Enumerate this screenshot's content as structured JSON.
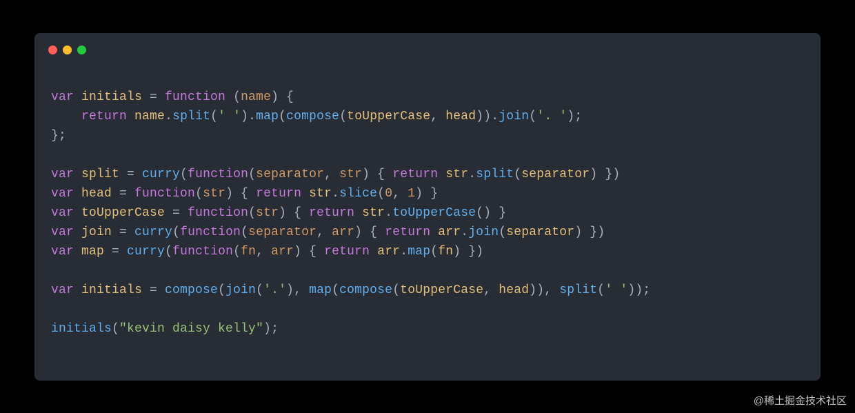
{
  "language": "javascript",
  "theme": "one-dark",
  "watermark": "@稀土掘金技术社区",
  "traffic_lights": [
    "close",
    "minimize",
    "zoom"
  ],
  "code_lines": [
    "",
    "var initials = function (name) {",
    "    return name.split(' ').map(compose(toUpperCase, head)).join('. ');",
    "};",
    "",
    "var split = curry(function(separator, str) { return str.split(separator) })",
    "var head = function(str) { return str.slice(0, 1) }",
    "var toUpperCase = function(str) { return str.toUpperCase() }",
    "var join = curry(function(separator, arr) { return arr.join(separator) })",
    "var map = curry(function(fn, arr) { return arr.map(fn) })",
    "",
    "var initials = compose(join('.'), map(compose(toUpperCase, head)), split(' '));",
    "",
    "initials(\"kevin daisy kelly\");",
    ""
  ],
  "tokens": {
    "blank": [
      {
        "t": " ",
        "c": "pl"
      }
    ],
    "l1": [
      {
        "t": "var ",
        "c": "kw"
      },
      {
        "t": "initials",
        "c": "vn"
      },
      {
        "t": " = ",
        "c": "pl"
      },
      {
        "t": "function",
        "c": "kw"
      },
      {
        "t": " (",
        "c": "pl"
      },
      {
        "t": "name",
        "c": "pn"
      },
      {
        "t": ") {",
        "c": "pl"
      }
    ],
    "l2": [
      {
        "t": "    ",
        "c": "pl"
      },
      {
        "t": "return",
        "c": "kw"
      },
      {
        "t": " ",
        "c": "pl"
      },
      {
        "t": "name",
        "c": "vn"
      },
      {
        "t": ".",
        "c": "pl"
      },
      {
        "t": "split",
        "c": "fnn"
      },
      {
        "t": "(",
        "c": "pl"
      },
      {
        "t": "' '",
        "c": "str"
      },
      {
        "t": ").",
        "c": "pl"
      },
      {
        "t": "map",
        "c": "fnn"
      },
      {
        "t": "(",
        "c": "pl"
      },
      {
        "t": "compose",
        "c": "fnn"
      },
      {
        "t": "(",
        "c": "pl"
      },
      {
        "t": "toUpperCase",
        "c": "vn"
      },
      {
        "t": ", ",
        "c": "pl"
      },
      {
        "t": "head",
        "c": "vn"
      },
      {
        "t": ")).",
        "c": "pl"
      },
      {
        "t": "join",
        "c": "fnn"
      },
      {
        "t": "(",
        "c": "pl"
      },
      {
        "t": "'. '",
        "c": "str"
      },
      {
        "t": ");",
        "c": "pl"
      }
    ],
    "l3": [
      {
        "t": "};",
        "c": "pl"
      }
    ],
    "l5": [
      {
        "t": "var ",
        "c": "kw"
      },
      {
        "t": "split",
        "c": "vn"
      },
      {
        "t": " = ",
        "c": "pl"
      },
      {
        "t": "curry",
        "c": "fnn"
      },
      {
        "t": "(",
        "c": "pl"
      },
      {
        "t": "function",
        "c": "kw"
      },
      {
        "t": "(",
        "c": "pl"
      },
      {
        "t": "separator",
        "c": "pn"
      },
      {
        "t": ", ",
        "c": "pl"
      },
      {
        "t": "str",
        "c": "pn"
      },
      {
        "t": ") { ",
        "c": "pl"
      },
      {
        "t": "return",
        "c": "kw"
      },
      {
        "t": " ",
        "c": "pl"
      },
      {
        "t": "str",
        "c": "vn"
      },
      {
        "t": ".",
        "c": "pl"
      },
      {
        "t": "split",
        "c": "fnn"
      },
      {
        "t": "(",
        "c": "pl"
      },
      {
        "t": "separator",
        "c": "vn"
      },
      {
        "t": ") })",
        "c": "pl"
      }
    ],
    "l6": [
      {
        "t": "var ",
        "c": "kw"
      },
      {
        "t": "head",
        "c": "vn"
      },
      {
        "t": " = ",
        "c": "pl"
      },
      {
        "t": "function",
        "c": "kw"
      },
      {
        "t": "(",
        "c": "pl"
      },
      {
        "t": "str",
        "c": "pn"
      },
      {
        "t": ") { ",
        "c": "pl"
      },
      {
        "t": "return",
        "c": "kw"
      },
      {
        "t": " ",
        "c": "pl"
      },
      {
        "t": "str",
        "c": "vn"
      },
      {
        "t": ".",
        "c": "pl"
      },
      {
        "t": "slice",
        "c": "fnn"
      },
      {
        "t": "(",
        "c": "pl"
      },
      {
        "t": "0",
        "c": "num"
      },
      {
        "t": ", ",
        "c": "pl"
      },
      {
        "t": "1",
        "c": "num"
      },
      {
        "t": ") }",
        "c": "pl"
      }
    ],
    "l7": [
      {
        "t": "var ",
        "c": "kw"
      },
      {
        "t": "toUpperCase",
        "c": "vn"
      },
      {
        "t": " = ",
        "c": "pl"
      },
      {
        "t": "function",
        "c": "kw"
      },
      {
        "t": "(",
        "c": "pl"
      },
      {
        "t": "str",
        "c": "pn"
      },
      {
        "t": ") { ",
        "c": "pl"
      },
      {
        "t": "return",
        "c": "kw"
      },
      {
        "t": " ",
        "c": "pl"
      },
      {
        "t": "str",
        "c": "vn"
      },
      {
        "t": ".",
        "c": "pl"
      },
      {
        "t": "toUpperCase",
        "c": "fnn"
      },
      {
        "t": "() }",
        "c": "pl"
      }
    ],
    "l8": [
      {
        "t": "var ",
        "c": "kw"
      },
      {
        "t": "join",
        "c": "vn"
      },
      {
        "t": " = ",
        "c": "pl"
      },
      {
        "t": "curry",
        "c": "fnn"
      },
      {
        "t": "(",
        "c": "pl"
      },
      {
        "t": "function",
        "c": "kw"
      },
      {
        "t": "(",
        "c": "pl"
      },
      {
        "t": "separator",
        "c": "pn"
      },
      {
        "t": ", ",
        "c": "pl"
      },
      {
        "t": "arr",
        "c": "pn"
      },
      {
        "t": ") { ",
        "c": "pl"
      },
      {
        "t": "return",
        "c": "kw"
      },
      {
        "t": " ",
        "c": "pl"
      },
      {
        "t": "arr",
        "c": "vn"
      },
      {
        "t": ".",
        "c": "pl"
      },
      {
        "t": "join",
        "c": "fnn"
      },
      {
        "t": "(",
        "c": "pl"
      },
      {
        "t": "separator",
        "c": "vn"
      },
      {
        "t": ") })",
        "c": "pl"
      }
    ],
    "l9": [
      {
        "t": "var ",
        "c": "kw"
      },
      {
        "t": "map",
        "c": "vn"
      },
      {
        "t": " = ",
        "c": "pl"
      },
      {
        "t": "curry",
        "c": "fnn"
      },
      {
        "t": "(",
        "c": "pl"
      },
      {
        "t": "function",
        "c": "kw"
      },
      {
        "t": "(",
        "c": "pl"
      },
      {
        "t": "fn",
        "c": "pn"
      },
      {
        "t": ", ",
        "c": "pl"
      },
      {
        "t": "arr",
        "c": "pn"
      },
      {
        "t": ") { ",
        "c": "pl"
      },
      {
        "t": "return",
        "c": "kw"
      },
      {
        "t": " ",
        "c": "pl"
      },
      {
        "t": "arr",
        "c": "vn"
      },
      {
        "t": ".",
        "c": "pl"
      },
      {
        "t": "map",
        "c": "fnn"
      },
      {
        "t": "(",
        "c": "pl"
      },
      {
        "t": "fn",
        "c": "vn"
      },
      {
        "t": ") })",
        "c": "pl"
      }
    ],
    "l11": [
      {
        "t": "var ",
        "c": "kw"
      },
      {
        "t": "initials",
        "c": "vn"
      },
      {
        "t": " = ",
        "c": "pl"
      },
      {
        "t": "compose",
        "c": "fnn"
      },
      {
        "t": "(",
        "c": "pl"
      },
      {
        "t": "join",
        "c": "fnn"
      },
      {
        "t": "(",
        "c": "pl"
      },
      {
        "t": "'.'",
        "c": "str"
      },
      {
        "t": "), ",
        "c": "pl"
      },
      {
        "t": "map",
        "c": "fnn"
      },
      {
        "t": "(",
        "c": "pl"
      },
      {
        "t": "compose",
        "c": "fnn"
      },
      {
        "t": "(",
        "c": "pl"
      },
      {
        "t": "toUpperCase",
        "c": "vn"
      },
      {
        "t": ", ",
        "c": "pl"
      },
      {
        "t": "head",
        "c": "vn"
      },
      {
        "t": ")), ",
        "c": "pl"
      },
      {
        "t": "split",
        "c": "fnn"
      },
      {
        "t": "(",
        "c": "pl"
      },
      {
        "t": "' '",
        "c": "str"
      },
      {
        "t": "));",
        "c": "pl"
      }
    ],
    "l13": [
      {
        "t": "initials",
        "c": "fnn"
      },
      {
        "t": "(",
        "c": "pl"
      },
      {
        "t": "\"kevin daisy kelly\"",
        "c": "str"
      },
      {
        "t": ");",
        "c": "pl"
      }
    ]
  },
  "line_order": [
    "blank",
    "l1",
    "l2",
    "l3",
    "blank",
    "l5",
    "l6",
    "l7",
    "l8",
    "l9",
    "blank",
    "l11",
    "blank",
    "l13",
    "blank"
  ]
}
